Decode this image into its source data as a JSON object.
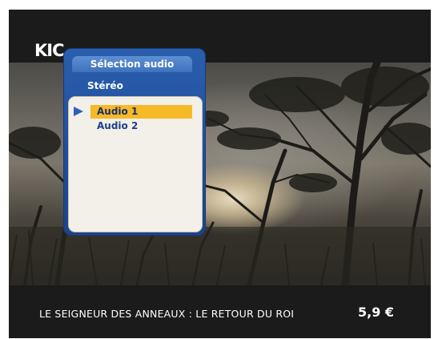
{
  "channel": {
    "logo_text": "KIC"
  },
  "audio_menu": {
    "title": "Sélection audio",
    "mode": "Stéréo",
    "options": [
      {
        "label": "Audio 1",
        "selected": true
      },
      {
        "label": "Audio 2",
        "selected": false
      }
    ]
  },
  "program": {
    "title": "LE SEIGNEUR DES ANNEAUX : LE RETOUR DU ROI",
    "price": "5,9 €"
  },
  "colors": {
    "panel_blue": "#1f4c99",
    "selection_highlight": "#f6b928",
    "list_background": "#f2f0e8"
  }
}
